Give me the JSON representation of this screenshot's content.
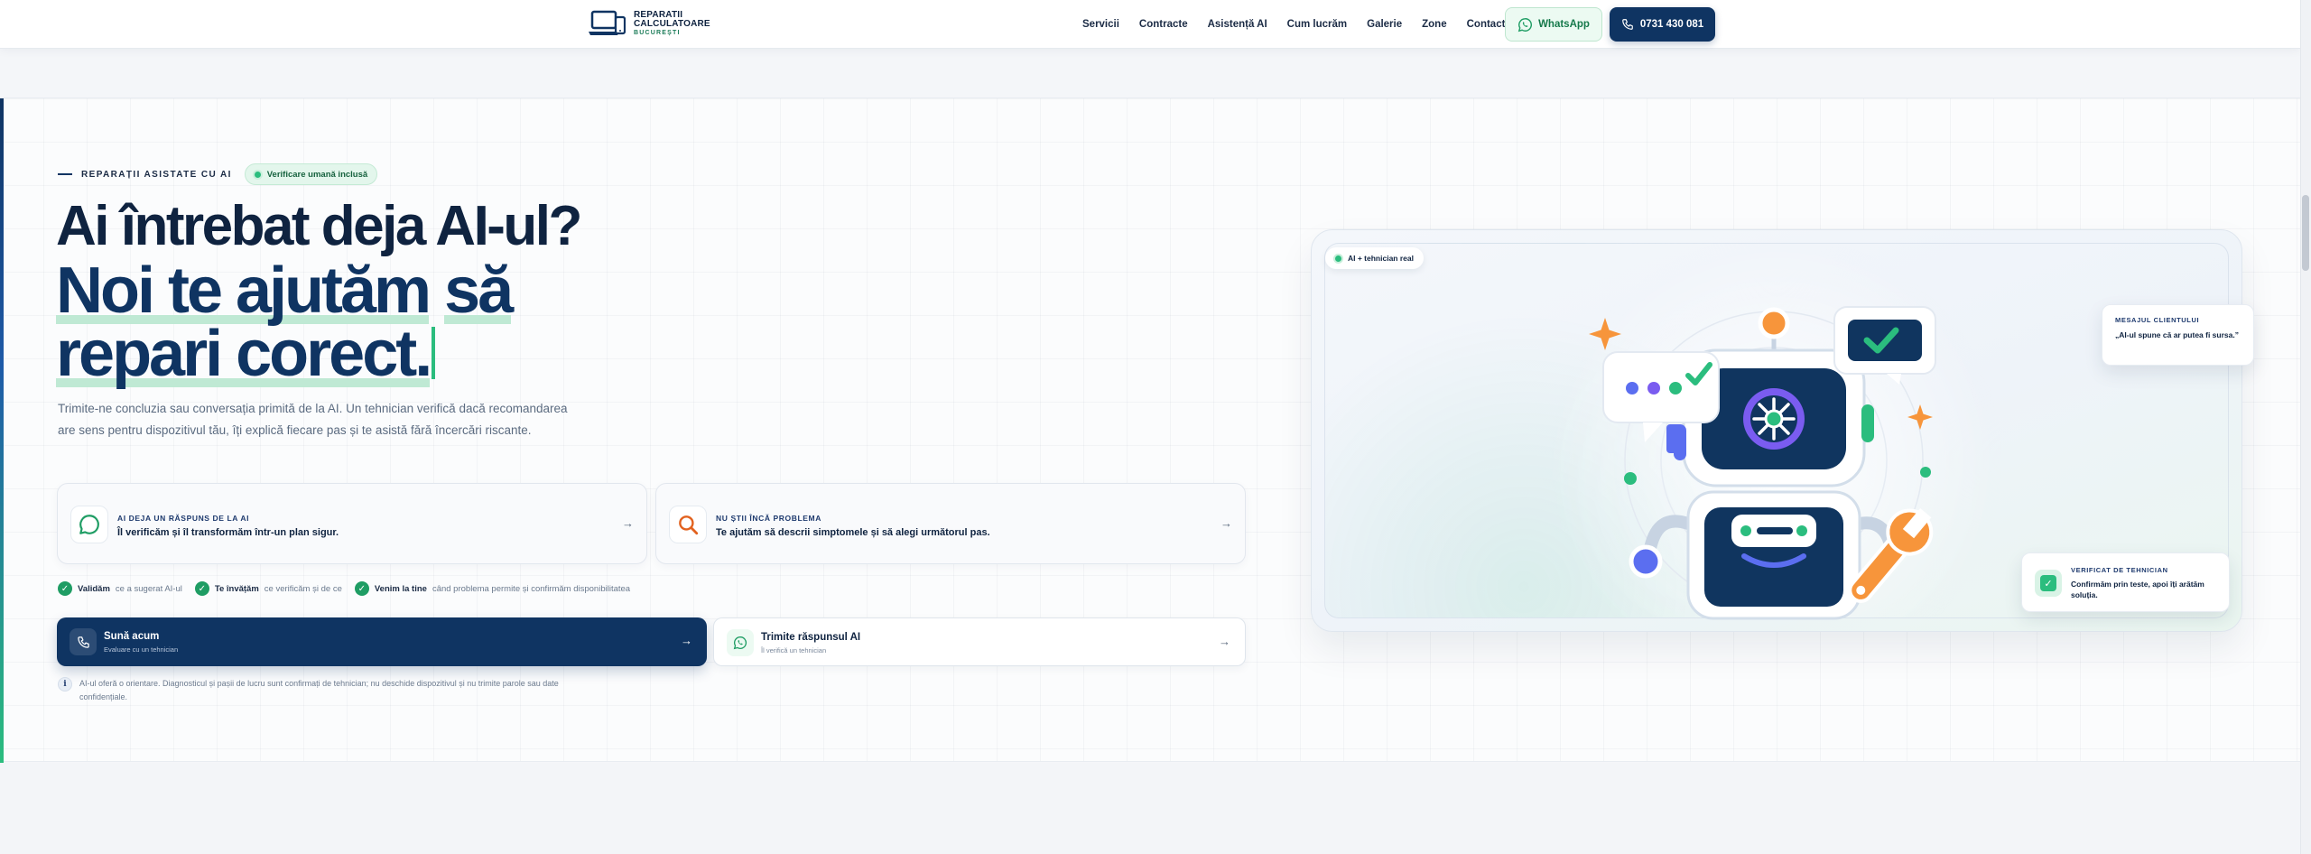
{
  "header": {
    "logo": {
      "line1": "REPARATII",
      "line2": "CALCULATOARE",
      "line3": "BUCUREȘTI"
    },
    "nav": [
      "Servicii",
      "Contracte",
      "Asistență AI",
      "Cum lucrăm",
      "Galerie",
      "Zone",
      "Contact"
    ],
    "whatsapp_label": "WhatsApp",
    "phone_label": "0731 430 081"
  },
  "hero": {
    "eyebrow": "REPARAȚII ASISTATE CU AI",
    "badge": "Verificare umană inclusă",
    "title_line1": "Ai întrebat deja AI-ul?",
    "title_line2_a": "Noi te ajutăm",
    "title_line2_b": "să",
    "title_line3": "repari corect.",
    "lead": "Trimite-ne concluzia sau conversația primită de la AI. Un tehnician verifică dacă recomandarea are sens pentru dispozitivul tău, îți explică fiecare pas și te asistă fără încercări riscante.",
    "cards": [
      {
        "kicker": "AI DEJA UN RĂSPUNS DE LA AI",
        "text": "Îl verificăm și îl transformăm într-un plan sigur.",
        "arrow": "→",
        "icon": "chat-bubble-icon"
      },
      {
        "kicker": "NU ȘTII ÎNCĂ PROBLEMA",
        "text": "Te ajutăm să descrii simptomele și să alegi următorul pas.",
        "arrow": "→",
        "icon": "search-icon"
      }
    ],
    "checks": [
      {
        "strong": "Validăm",
        "rest": "ce a sugerat AI-ul"
      },
      {
        "strong": "Te învățăm",
        "rest": "ce verificăm și de ce"
      },
      {
        "strong": "Venim la tine",
        "rest": "când problema permite și confirmăm disponibilitatea"
      }
    ],
    "cta_call": {
      "title": "Sună acum",
      "sub": "Evaluare cu un tehnician",
      "arrow": "→"
    },
    "cta_whatsapp": {
      "title": "Trimite răspunsul AI",
      "sub": "Îl verifică un tehnician",
      "arrow": "→"
    },
    "note_icon": "i",
    "note": "AI-ul oferă o orientare. Diagnosticul și pașii de lucru sunt confirmați de tehnician; nu deschide dispozitivul și nu trimite parole sau date confidențiale."
  },
  "illustration": {
    "badge": "AI + tehnician real",
    "client_card": {
      "kicker": "MESAJUL CLIENTULUI",
      "quote": "„AI-ul spune că ar putea fi sursa.”"
    },
    "tech_card": {
      "kicker": "VERIFICAT DE TEHNICIAN",
      "text": "Confirmăm prin teste, apoi îți arătăm soluția."
    }
  },
  "colors": {
    "navy": "#0f3462",
    "green": "#2bbd7e",
    "orange": "#f7953b",
    "purple": "#7a5cf0",
    "blue": "#5b6ef0"
  }
}
